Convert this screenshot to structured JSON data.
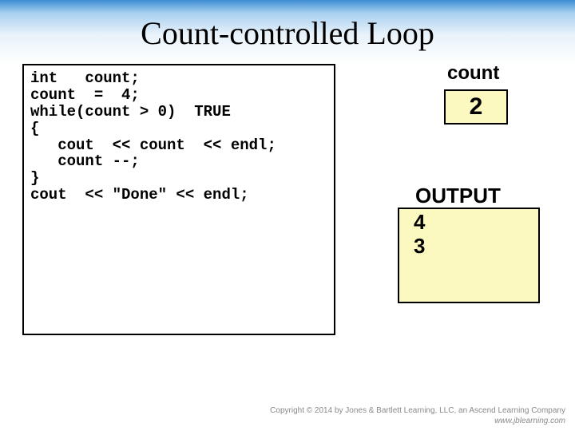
{
  "title": "Count-controlled Loop",
  "code": {
    "l1": "int   count;",
    "l2": "",
    "l3": "count  =  4;",
    "l4": "",
    "l5a": "while(count > 0)",
    "l5true": "  TRUE",
    "l6": "{",
    "l7": "   cout  << count  << endl;",
    "l8": "",
    "l9": "   count --;",
    "l10": "}",
    "l11": "cout  << \"Done\" << endl;"
  },
  "variable": {
    "name": "count",
    "value": "2"
  },
  "output": {
    "label": "OUTPUT",
    "lines": [
      "4",
      "3"
    ]
  },
  "footer": {
    "copyright": "Copyright © 2014 by Jones & Bartlett Learning, LLC, an Ascend Learning Company",
    "site": "www.jblearning.com"
  }
}
